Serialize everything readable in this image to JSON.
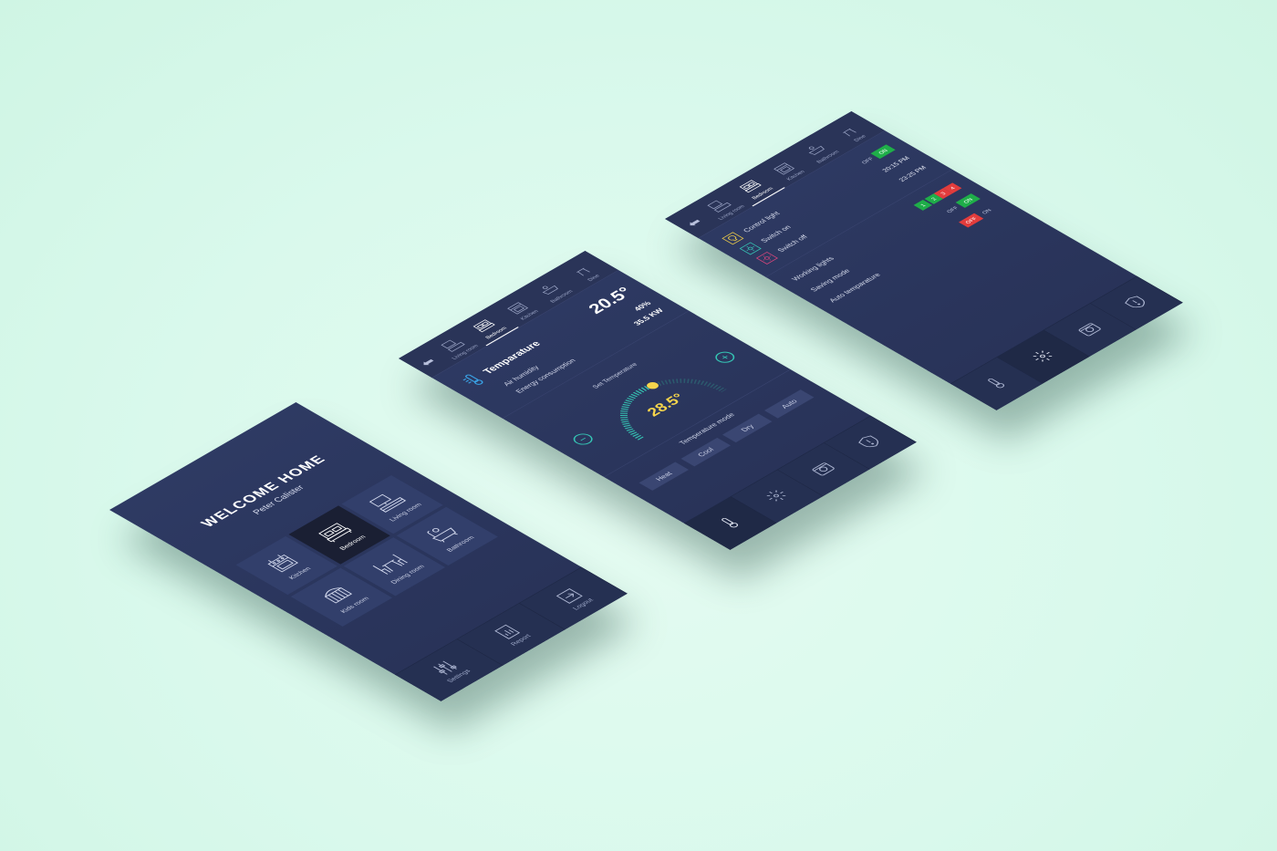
{
  "home": {
    "title": "WELCOME  HOME",
    "user": "Peter Calister",
    "rooms": [
      "Kitchen",
      "Bedroom",
      "Living room",
      "Kids room",
      "Dining room",
      "Bathroom"
    ],
    "nav": [
      "Settings",
      "Report",
      "Logout"
    ]
  },
  "tabs": [
    "Living room",
    "Bedroom",
    "Kitchen",
    "Bathroom",
    "Dine"
  ],
  "temperature": {
    "label": "Temparature",
    "value": "20.5°",
    "humidity_label": "Air humidity",
    "humidity_value": "40%",
    "energy_label": "Energy consumption",
    "energy_value": "35.5 KW",
    "set_label": "Set  Temperature",
    "set_value": "28.5°",
    "set_fraction": 0.58,
    "mode_label": "Temperature mode",
    "modes": [
      "Heat",
      "Cool",
      "Dry",
      "Auto"
    ]
  },
  "lights": {
    "control_label": "Control  light",
    "switch_on_label": "Switch on",
    "switch_on_time": "20:15  PM",
    "switch_off_label": "Switch off",
    "switch_off_time": "23:25  PM",
    "off": "OFF",
    "on": "ON",
    "working_label": "Working lights",
    "working_numbers": [
      "1",
      "2",
      "3",
      "4"
    ],
    "saving_label": "Saving mode",
    "auto_label": "Auto temparature"
  },
  "colors": {
    "accent_teal": "#35c4b4",
    "accent_yellow": "#f6d54c",
    "on_green": "#1fae49",
    "off_red": "#e23c3c",
    "background": "#d9f9ec"
  }
}
